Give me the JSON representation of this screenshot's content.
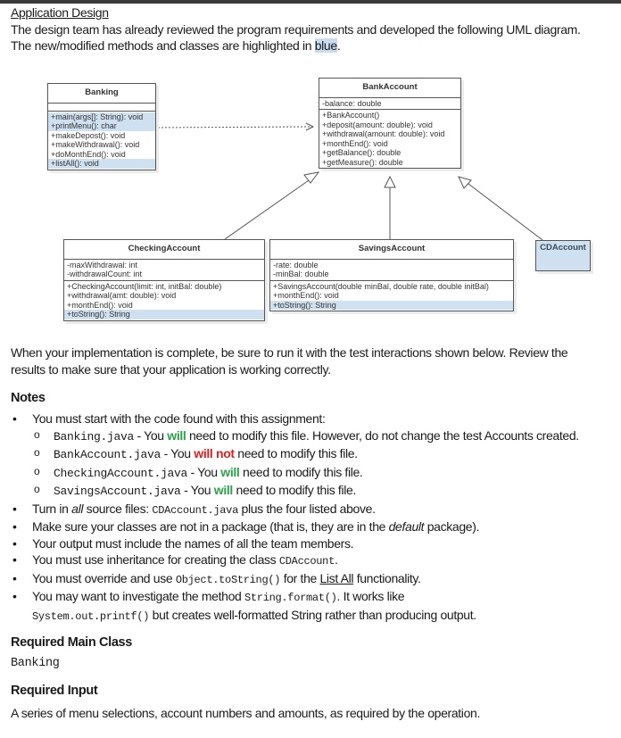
{
  "heading": "Application Design",
  "intro": {
    "text_before": "The design team has already reviewed the program requirements and developed the following UML diagram. The new/modified methods and classes are highlighted in ",
    "highlight": "blue",
    "text_after": "."
  },
  "uml": {
    "classes": {
      "banking": {
        "name": "Banking",
        "attributes": [],
        "methods": [
          {
            "text": "+main(args[]: String): void",
            "highlight": true
          },
          {
            "text": "+printMenu(): char",
            "highlight": true
          },
          {
            "text": "+makeDepost(): void",
            "highlight": false
          },
          {
            "text": "+makeWithdrawal(): void",
            "highlight": false
          },
          {
            "text": "+doMonthEnd(): void",
            "highlight": false
          },
          {
            "text": "+listAll(): void",
            "highlight": true
          }
        ]
      },
      "bank_account": {
        "name": "BankAccount",
        "attributes": [
          {
            "text": "-balance: double",
            "highlight": false
          }
        ],
        "methods": [
          {
            "text": "+BankAccount()",
            "highlight": false
          },
          {
            "text": "+deposit(amount: double): void",
            "highlight": false
          },
          {
            "text": "+withdrawal(amount: double): void",
            "highlight": false
          },
          {
            "text": "+monthEnd(): void",
            "highlight": false
          },
          {
            "text": "+getBalance(): double",
            "highlight": false
          },
          {
            "text": "+getMeasure(): double",
            "highlight": false
          }
        ]
      },
      "checking_account": {
        "name": "CheckingAccount",
        "attributes": [
          {
            "text": "-maxWithdrawal: int",
            "highlight": false
          },
          {
            "text": "-withdrawalCount: int",
            "highlight": false
          }
        ],
        "methods": [
          {
            "text": "+CheckingAccount(limit: int, initBal: double)",
            "highlight": false
          },
          {
            "text": "+withdrawal(amt: double): void",
            "highlight": false
          },
          {
            "text": "+monthEnd(): void",
            "highlight": false
          },
          {
            "text": "+toString(): String",
            "highlight": true
          }
        ]
      },
      "savings_account": {
        "name": "SavingsAccount",
        "attributes": [
          {
            "text": "-rate: double",
            "highlight": false
          },
          {
            "text": "-minBal: double",
            "highlight": false
          }
        ],
        "methods": [
          {
            "text": "+SavingsAccount(double minBal, double rate, double initBal)",
            "highlight": false
          },
          {
            "text": "+monthEnd(): void",
            "highlight": false
          },
          {
            "text": "+toString(): String",
            "highlight": true
          }
        ]
      },
      "cd_account": {
        "name": "CDAccount",
        "highlight": true
      }
    },
    "relations": [
      {
        "from": "Banking",
        "to": "BankAccount",
        "type": "dependency"
      },
      {
        "from": "CheckingAccount",
        "to": "BankAccount",
        "type": "inheritance"
      },
      {
        "from": "SavingsAccount",
        "to": "BankAccount",
        "type": "inheritance"
      },
      {
        "from": "CDAccount",
        "to": "BankAccount",
        "type": "inheritance"
      }
    ]
  },
  "test_note": "When your implementation is complete, be sure to run it with the test interactions shown below. Review the results to make sure that your application is working correctly.",
  "notes": {
    "title": "Notes",
    "start_item": "You must start with the code found with this assignment:",
    "files": [
      {
        "file": "Banking.java",
        "pre": " - You ",
        "mod": "will",
        "mod_color": "green",
        "post": " need to modify this file. However, do not change the test Accounts created."
      },
      {
        "file": "BankAccount.java",
        "pre": " - You ",
        "mod": "will not",
        "mod_color": "red",
        "post": " need to modify this file."
      },
      {
        "file": "CheckingAccount.java",
        "pre": " - You ",
        "mod": "will",
        "mod_color": "green",
        "post": " need to modify this file."
      },
      {
        "file": "SavingsAccount.java",
        "pre": " - You ",
        "mod": "will",
        "mod_color": "green",
        "post": " need to modify this file."
      }
    ],
    "turn_in": {
      "pre": "Turn in ",
      "ital": "all",
      "mid": " source files: ",
      "code": "CDAccount.java",
      "post": " plus the four listed above."
    },
    "package": {
      "pre": "Make sure your classes are not in a package (that is, they are in the ",
      "ital": "default",
      "post": " package)."
    },
    "names": "Your output must include the names of all the team members.",
    "inherit": {
      "pre": "You must use inheritance for creating the class ",
      "code": "CDAccount",
      "post": "."
    },
    "override": {
      "pre": "You must override and use ",
      "code": "Object.toString()",
      "mid": " for the ",
      "link": "List All",
      "post": " functionality."
    },
    "format": {
      "pre": "You may want to investigate the method ",
      "code": "String.format()",
      "mid": ". It works like",
      "code2": "System.out.printf()",
      "post": " but creates well-formatted String rather than producing output."
    }
  },
  "required_main": {
    "title": "Required Main Class",
    "value": "Banking"
  },
  "required_input": {
    "title": "Required Input",
    "value": "A series of menu selections, account numbers and amounts, as required by the operation."
  },
  "colors": {
    "highlight_blue": "#cfe0f1",
    "will_green": "#2aa14a",
    "will_not_red": "#e0201f"
  }
}
